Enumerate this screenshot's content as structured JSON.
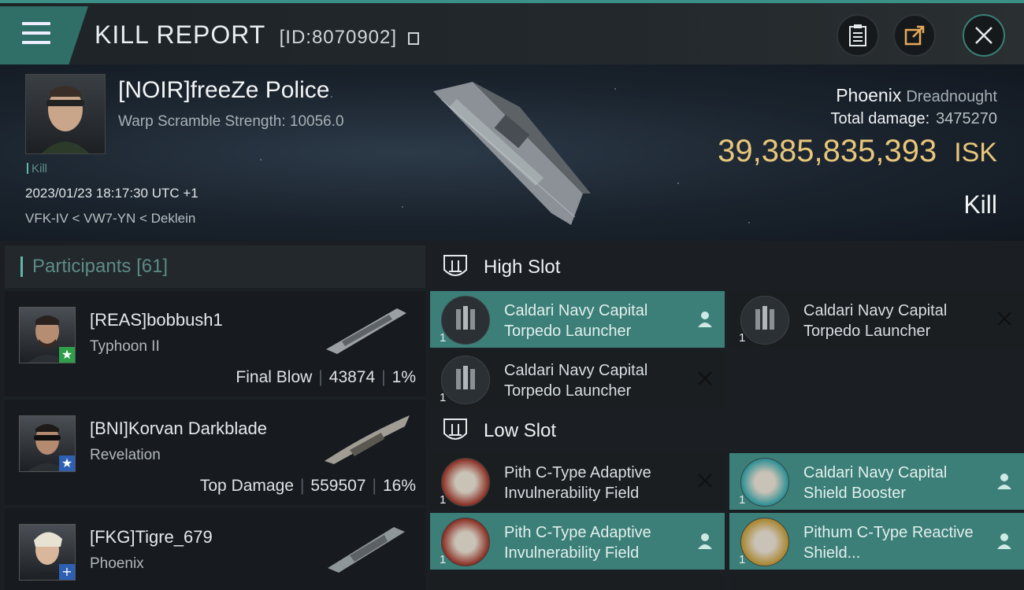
{
  "titlebar": {
    "title": "KILL REPORT",
    "id_label": "[ID:8070902]",
    "buttons": [
      "menu-icon",
      "clipboard-icon",
      "share-icon",
      "close-icon"
    ]
  },
  "victim": {
    "name": "[NOIR]freeZe Police",
    "warp_scramble": "Warp Scramble Strength: 10056.0",
    "tag": "Kill",
    "datetime": "2023/01/23 18:17:30 UTC +1",
    "location": "VFK-IV < VW7-YN < Deklein",
    "ship_name": "Phoenix",
    "ship_class": "Dreadnought",
    "total_damage_label": "Total damage:",
    "total_damage_value": "3475270",
    "isk_value": "39,385,835,393",
    "isk_unit": "ISK",
    "result": "Kill"
  },
  "participants": {
    "label": "Participants",
    "count": "[61]",
    "rows": [
      {
        "name": "[REAS]bobbush1",
        "ship": "Typhoon II",
        "role": "Final Blow",
        "damage": "43874",
        "percent": "1%",
        "badge": "★",
        "badge_color": "#2e9e4a"
      },
      {
        "name": "[BNI]Korvan Darkblade",
        "ship": "Revelation",
        "role": "Top Damage",
        "damage": "559507",
        "percent": "16%",
        "badge": "★",
        "badge_color": "#2d5fb3"
      },
      {
        "name": "[FKG]Tigre_679",
        "ship": "Phoenix",
        "role": "",
        "damage": "",
        "percent": "",
        "badge": "+",
        "badge_color": "#2d5fb3"
      }
    ]
  },
  "slots": {
    "high": {
      "label": "High Slot",
      "modules": [
        {
          "name": "Caldari Navy Capital Torpedo Launcher",
          "qty": "1",
          "state": "pilot"
        },
        {
          "name": "Caldari Navy Capital Torpedo Launcher",
          "qty": "1",
          "state": "destroyed"
        },
        {
          "name": "Caldari Navy Capital Torpedo Launcher",
          "qty": "1",
          "state": "destroyed"
        }
      ]
    },
    "low": {
      "label": "Low Slot",
      "modules": [
        {
          "name": "Pith C-Type Adaptive Invulnerability Field",
          "qty": "1",
          "state": "destroyed"
        },
        {
          "name": "Caldari Navy Capital Shield Booster",
          "qty": "1",
          "state": "pilot"
        },
        {
          "name": "Pith C-Type Adaptive Invulnerability Field",
          "qty": "1",
          "state": "pilot"
        },
        {
          "name": "Pithum C-Type Reactive Shield...",
          "qty": "1",
          "state": "pilot"
        }
      ]
    }
  },
  "colors": {
    "accent": "#3b7f78",
    "isk": "#e8c67a",
    "panel": "#1b2024"
  }
}
